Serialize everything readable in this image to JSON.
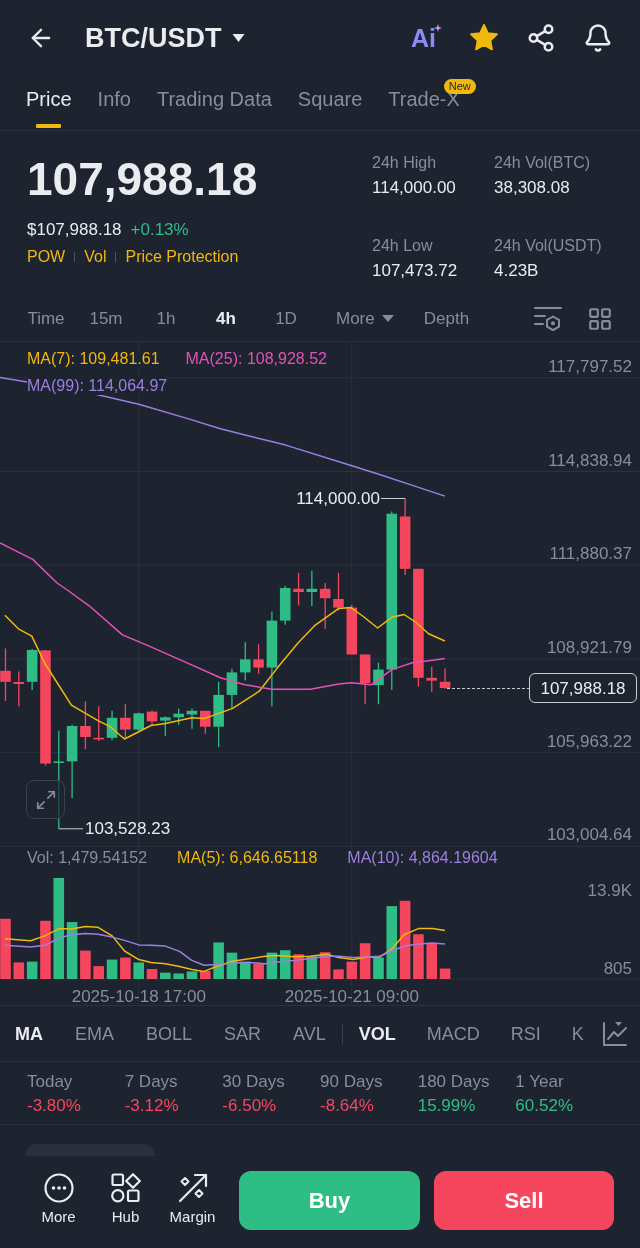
{
  "header": {
    "title": "BTC/USDT",
    "ai_label": "Ai",
    "favorite": true
  },
  "tabs": [
    {
      "label": "Price",
      "selected": true
    },
    {
      "label": "Info",
      "selected": false
    },
    {
      "label": "Trading Data",
      "selected": false
    },
    {
      "label": "Square",
      "selected": false
    },
    {
      "label": "Trade-X",
      "selected": false,
      "badge": "New"
    }
  ],
  "ticker": {
    "price": "107,988.18",
    "price_usd": "$107,988.18",
    "change": "+0.13%",
    "rising": true,
    "tags": [
      "POW",
      "Vol",
      "Price Protection"
    ],
    "stats": [
      {
        "label": "24h High",
        "value": "114,000.00"
      },
      {
        "label": "24h Vol(BTC)",
        "value": "38,308.08"
      },
      {
        "label": "24h Low",
        "value": "107,473.72"
      },
      {
        "label": "24h Vol(USDT)",
        "value": "4.23B"
      }
    ]
  },
  "intervals": [
    {
      "label": "Time",
      "kind": "interval",
      "selected": false
    },
    {
      "label": "15m",
      "kind": "interval",
      "selected": false
    },
    {
      "label": "1h",
      "kind": "interval",
      "selected": false
    },
    {
      "label": "4h",
      "kind": "interval",
      "selected": true
    },
    {
      "label": "1D",
      "kind": "interval",
      "selected": false
    },
    {
      "label": "More",
      "kind": "dropdown",
      "selected": false
    },
    {
      "label": "Depth",
      "kind": "view",
      "selected": false
    }
  ],
  "chart": {
    "ma_legend": [
      {
        "label": "MA(7): 109,481.61",
        "color": "#f0b90b"
      },
      {
        "label": "MA(25): 108,928.52",
        "color": "#e550b8"
      },
      {
        "label": "MA(99): 114,064.97",
        "color": "#9c7fe0"
      }
    ],
    "price_axis": [
      "117,797.52",
      "114,838.94",
      "111,880.37",
      "108,921.79",
      "105,963.22",
      "103,004.64"
    ],
    "high_label": "114,000.00",
    "low_label": "103,528.23",
    "last_price": "107,988.18"
  },
  "volume": {
    "legend": [
      {
        "label": "Vol: 1,479.54152",
        "color": "#848e9c"
      },
      {
        "label": "MA(5): 6,646.65118",
        "color": "#f0b90b"
      },
      {
        "label": "MA(10): 4,864.19604",
        "color": "#9c7fe0"
      }
    ],
    "axis": [
      "13.9K",
      "805"
    ],
    "dates": [
      "2025-10-18 17:00",
      "2025-10-21 09:00"
    ]
  },
  "indicators": {
    "main": [
      {
        "label": "MA",
        "selected": true
      },
      {
        "label": "EMA",
        "selected": false
      },
      {
        "label": "BOLL",
        "selected": false
      },
      {
        "label": "SAR",
        "selected": false
      },
      {
        "label": "AVL",
        "selected": false
      }
    ],
    "sub": [
      {
        "label": "VOL",
        "selected": true
      },
      {
        "label": "MACD",
        "selected": false
      },
      {
        "label": "RSI",
        "selected": false
      },
      {
        "label": "K",
        "selected": false
      }
    ]
  },
  "performance": [
    {
      "period": "Today",
      "change": "-3.80%",
      "rising": false
    },
    {
      "period": "7 Days",
      "change": "-3.12%",
      "rising": false
    },
    {
      "period": "30 Days",
      "change": "-6.50%",
      "rising": false
    },
    {
      "period": "90 Days",
      "change": "-8.64%",
      "rising": false
    },
    {
      "period": "180 Days",
      "change": "15.99%",
      "rising": true
    },
    {
      "period": "1 Year",
      "change": "60.52%",
      "rising": true
    }
  ],
  "bottom_bar": {
    "actions": [
      {
        "label": "More"
      },
      {
        "label": "Hub"
      },
      {
        "label": "Margin"
      }
    ],
    "buy": "Buy",
    "sell": "Sell"
  }
}
